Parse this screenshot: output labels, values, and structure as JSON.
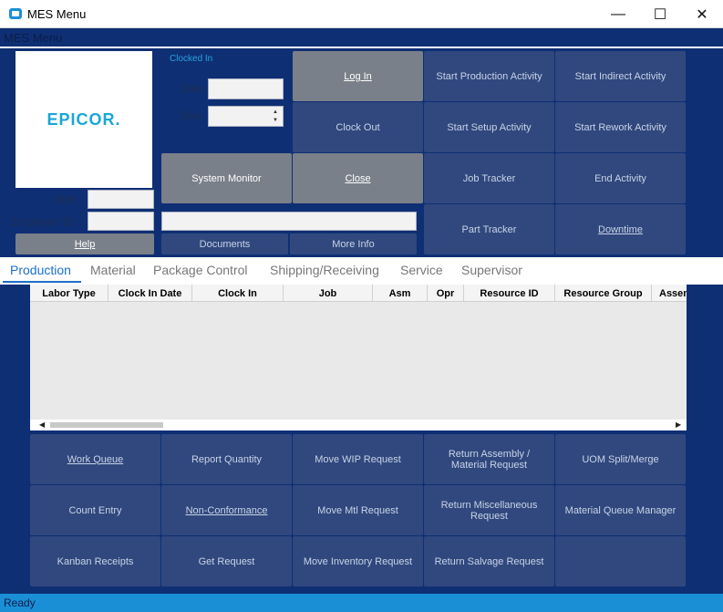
{
  "window": {
    "title": "MES Menu",
    "minimize": "—",
    "maximize": "☐",
    "close": "✕"
  },
  "menubar": {
    "label": "MES Menu"
  },
  "logo": {
    "text": "EPICOR."
  },
  "login": {
    "status": "Clocked In",
    "date_label": "Date:",
    "date_value": "",
    "time_label": "Time:",
    "time_value": "",
    "shift_label": "Shift:",
    "shift_value": "",
    "employee_label": "Employee ID:",
    "employee_value": "",
    "employee_name": ""
  },
  "buttons": {
    "log_in": "Log In",
    "clock_out": "Clock Out",
    "system_monitor": "System Monitor",
    "close": "Close",
    "help": "Help",
    "documents": "Documents",
    "more_info": "More Info",
    "start_production": "Start Production Activity",
    "start_indirect": "Start Indirect Activity",
    "start_setup": "Start Setup Activity",
    "start_rework": "Start Rework Activity",
    "job_tracker": "Job Tracker",
    "end_activity": "End Activity",
    "part_tracker": "Part Tracker",
    "downtime": "Downtime"
  },
  "tabs": [
    {
      "label": "Production",
      "active": true
    },
    {
      "label": "Material"
    },
    {
      "label": "Package Control"
    },
    {
      "label": "Shipping/Receiving"
    },
    {
      "label": "Service"
    },
    {
      "label": "Supervisor"
    }
  ],
  "grid": {
    "columns": [
      "Labor Type",
      "Clock In Date",
      "Clock In",
      "Job",
      "Asm",
      "Opr",
      "Resource ID",
      "Resource Group",
      "Assem"
    ],
    "rows": []
  },
  "actions": {
    "work_queue": "Work Queue",
    "report_quantity": "Report Quantity",
    "move_wip": "Move WIP Request",
    "return_assembly": "Return Assembly / Material Request",
    "uom_split": "UOM Split/Merge",
    "count_entry": "Count Entry",
    "non_conformance": "Non-Conformance",
    "move_mtl": "Move Mtl Request",
    "return_misc": "Return Miscellaneous Request",
    "material_queue": "Material Queue Manager",
    "kanban": "Kanban Receipts",
    "get_request": "Get Request",
    "move_inventory": "Move Inventory Request",
    "return_salvage": "Return Salvage Request"
  },
  "status": {
    "text": "Ready"
  },
  "colors": {
    "background": "#0f2f74",
    "button": "#30487e",
    "accent": "#1a8fd6",
    "gray_button": "#7a8089"
  }
}
